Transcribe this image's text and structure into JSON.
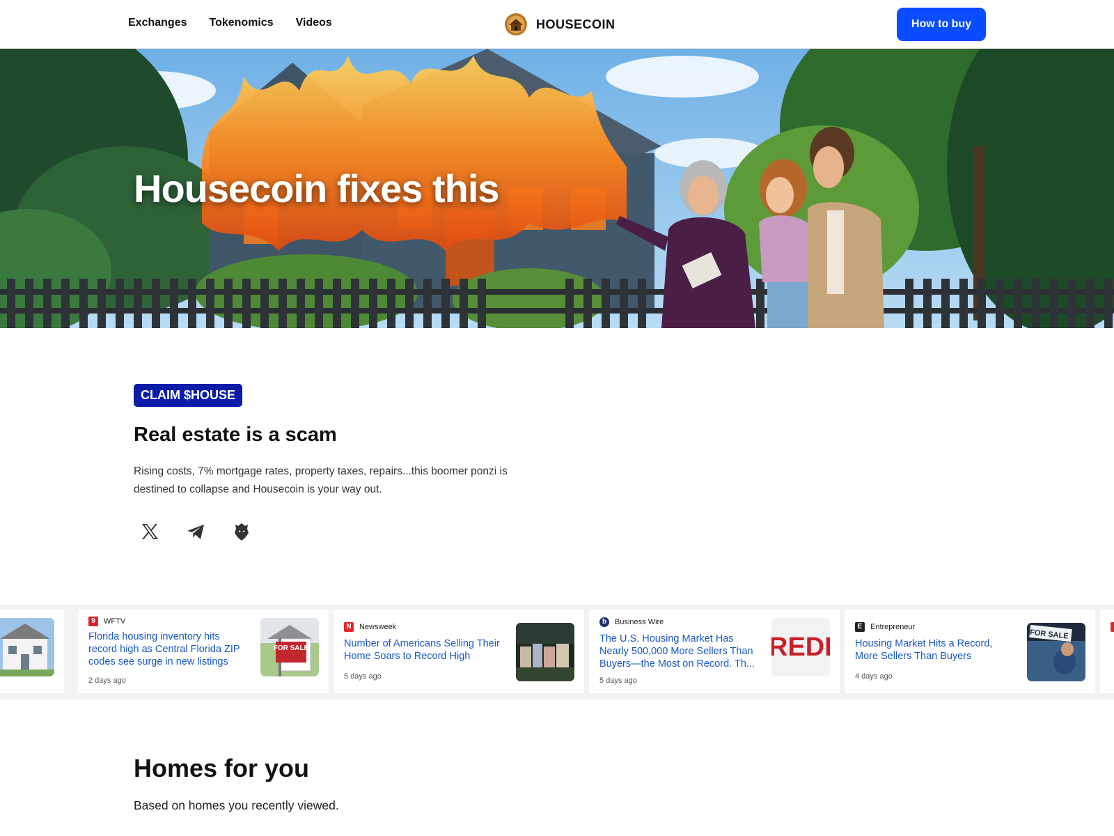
{
  "nav": {
    "links": [
      "Exchanges",
      "Tokenomics",
      "Videos"
    ],
    "brand": "HOUSECOIN",
    "cta": "How to buy"
  },
  "hero": {
    "title": "Housecoin fixes this"
  },
  "claim": {
    "badge": "CLAIM $HOUSE",
    "headline": "Real estate is a scam",
    "description": "Rising costs, 7% mortgage rates, property taxes, repairs...this boomer ponzi is destined to collapse and Housecoin is your way out."
  },
  "socials": [
    "x-icon",
    "telegram-icon",
    "dexscreener-icon"
  ],
  "news": [
    {
      "source": "WFTV",
      "title": "Florida housing inventory hits record high as Central Florida ZIP codes see surge in new listings",
      "age": "2 days ago"
    },
    {
      "source": "Newsweek",
      "title": "Number of Americans Selling Their Home Soars to Record High",
      "age": "5 days ago"
    },
    {
      "source": "Business Wire",
      "title": "The U.S. Housing Market Has Nearly 500,000 More Sellers Than Buyers—the Most on Record. Th...",
      "age": "5 days ago"
    },
    {
      "source": "Entrepreneur",
      "title": "Housing Market Hits a Record, More Sellers Than Buyers",
      "age": "4 days ago"
    }
  ],
  "thumb_text": {
    "for_sale_sign": "FOR SALE",
    "redfin_logo": "REDF",
    "for_sale_banner": "FOR SALE"
  },
  "homes": {
    "title": "Homes for you",
    "subtitle": "Based on homes you recently viewed."
  },
  "colors": {
    "accent": "#0a4cff",
    "badge": "#0b1ca8",
    "link": "#1a57c6"
  }
}
